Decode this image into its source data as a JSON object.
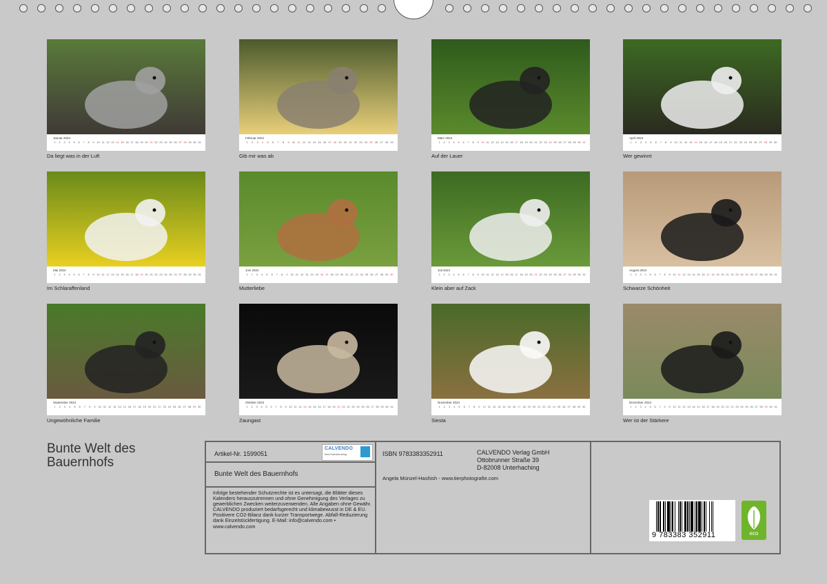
{
  "months": [
    {
      "name": "Januar 2024",
      "caption": "Da liegt was in der Luft",
      "days": 31,
      "sundays": [
        7,
        14,
        21,
        28
      ],
      "colors": [
        "#5a7a3a",
        "#3f3a36",
        "#a0a0a0"
      ],
      "subject": "sheep"
    },
    {
      "name": "Februar 2024",
      "caption": "Gib mir was ab",
      "days": 29,
      "sundays": [
        4,
        11,
        18,
        25
      ],
      "colors": [
        "#4b5a2c",
        "#e8cf7a",
        "#8a8070"
      ],
      "subject": "ducklings"
    },
    {
      "name": "März 2024",
      "caption": "Auf der Lauer",
      "days": 31,
      "sundays": [
        3,
        10,
        17,
        24,
        31
      ],
      "colors": [
        "#2f5a1c",
        "#5a8a2c",
        "#222"
      ],
      "subject": "cat"
    },
    {
      "name": "April 2024",
      "caption": "Wer gewinnt",
      "days": 30,
      "sundays": [
        7,
        14,
        21,
        28
      ],
      "colors": [
        "#3d6a22",
        "#2a2a20",
        "#eee"
      ],
      "subject": "roosters"
    },
    {
      "name": "Mai 2024",
      "caption": "Im Schlaraffenland",
      "days": 31,
      "sundays": [
        5,
        12,
        19,
        26
      ],
      "colors": [
        "#6a8a1a",
        "#e8d020",
        "#f2f2f2"
      ],
      "subject": "goat"
    },
    {
      "name": "Juni 2024",
      "caption": "Mutterliebe",
      "days": 30,
      "sundays": [
        2,
        9,
        16,
        23,
        30
      ],
      "colors": [
        "#5a8a2c",
        "#7aa040",
        "#b07040"
      ],
      "subject": "cows"
    },
    {
      "name": "Juli 2024",
      "caption": "Klein aber auf Zack",
      "days": 31,
      "sundays": [
        7,
        14,
        21,
        28
      ],
      "colors": [
        "#3d6a22",
        "#6a9a3a",
        "#eee"
      ],
      "subject": "chick"
    },
    {
      "name": "August 2024",
      "caption": "Schwarze Schönheit",
      "days": 31,
      "sundays": [
        4,
        11,
        18,
        25
      ],
      "colors": [
        "#b89a7a",
        "#d8c0a0",
        "#1a1a1a"
      ],
      "subject": "lamb"
    },
    {
      "name": "September 2024",
      "caption": "Ungewöhnliche Familie",
      "days": 30,
      "sundays": [
        1,
        8,
        15,
        22,
        29
      ],
      "colors": [
        "#4a7a2a",
        "#6a5a40",
        "#222"
      ],
      "subject": "hens"
    },
    {
      "name": "Oktober 2024",
      "caption": "Zaungast",
      "days": 31,
      "sundays": [
        6,
        13,
        20,
        27
      ],
      "colors": [
        "#0a0a0a",
        "#1a1a1a",
        "#c8b8a0"
      ],
      "subject": "goatblack"
    },
    {
      "name": "November 2024",
      "caption": "Siesta",
      "days": 30,
      "sundays": [
        3,
        10,
        17,
        24
      ],
      "colors": [
        "#4a6a2a",
        "#8a7040",
        "#fafafa"
      ],
      "subject": "geese"
    },
    {
      "name": "Dezember 2024",
      "caption": "Wer ist der Stärkere",
      "days": 31,
      "sundays": [
        1,
        8,
        15,
        22,
        29
      ],
      "colors": [
        "#9a8a6a",
        "#7a8a5a",
        "#1a1a1a"
      ],
      "subject": "lambs"
    }
  ],
  "cover_title": "Bunte Welt des Bauernhofs",
  "info": {
    "article": "Artikel-Nr. 1599051",
    "logo": "CALVENDO",
    "logo_sub": "Mein Kalenderverlag",
    "subtitle": "Bunte Welt des Bauernhofs",
    "legal": "Infolge bestehender Schutzrechte ist es untersagt, die Blätter dieses Kalenders herauszutrennen und ohne Genehmigung des Verlages zu gewerblichen Zwecken weiterzuverwenden. Alle Angaben ohne Gewähr. CALVENDO produziert bedarfsgerecht und klimabewusst in DE & EU. Positivere CO2-Bilanz dank kurzer Transportwege. Abfall-Reduzierung dank Einzelstückfertigung. E-Mail: info@calvendo.com • www.calvendo.com",
    "isbn": "ISBN 9783383352911",
    "publisher_1": "CALVENDO Verlag GmbH",
    "publisher_2": "Ottobrunner Straße 39",
    "publisher_3": "D-82008 Unterhaching",
    "author": "Angela Münzel-Hashish - www.tierphotografie.com",
    "barcode_number": "9 783383 352911",
    "eco": "eco"
  }
}
